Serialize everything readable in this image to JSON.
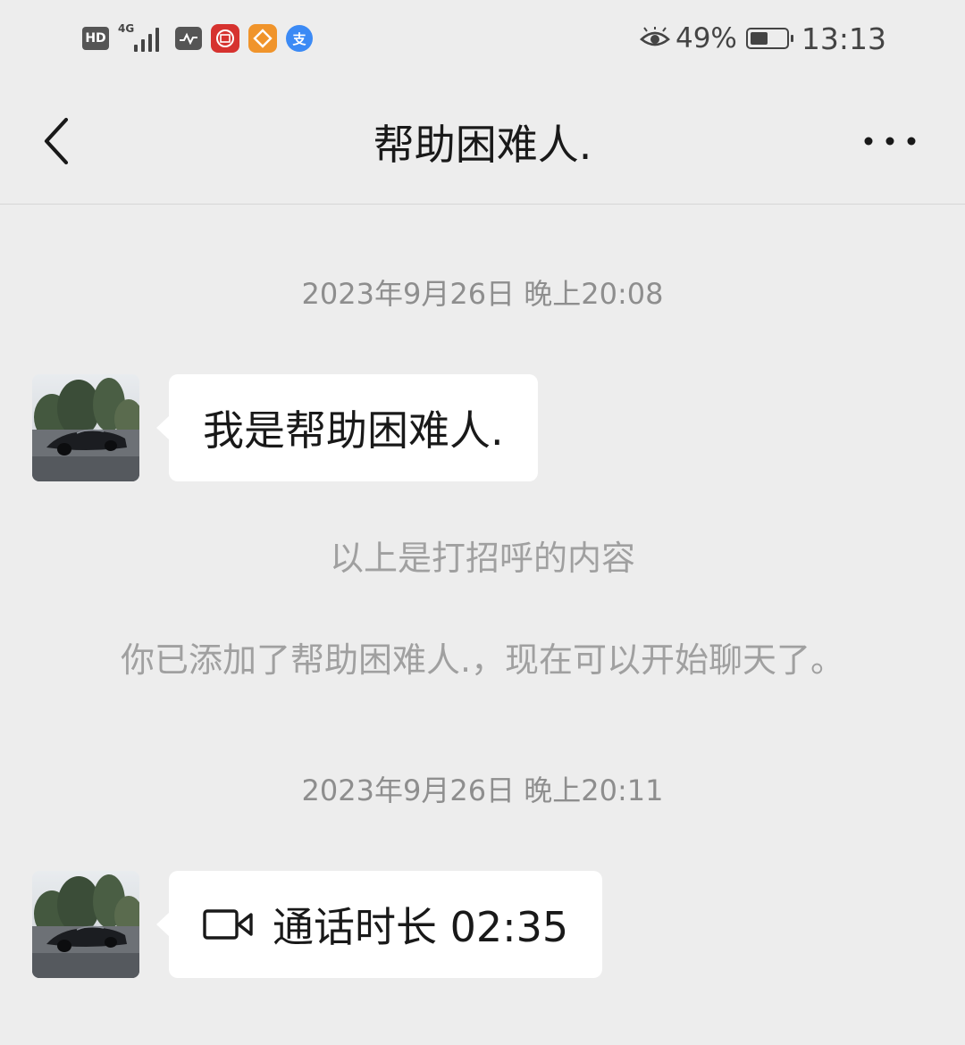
{
  "status_bar": {
    "hd_label": "HD",
    "network_label": "4G",
    "app_icons": [
      "activity-monitor-icon",
      "bank-app-icon",
      "orange-app-icon",
      "alipay-icon"
    ],
    "alipay_glyph": "支",
    "battery_percent": "49%",
    "battery_level": 0.49,
    "time": "13:13"
  },
  "nav": {
    "title": "帮助困难人."
  },
  "messages": {
    "timestamp_1": "2023年9月26日 晚上20:08",
    "greeting_text": "我是帮助困难人.",
    "note_greeting": "以上是打招呼的内容",
    "note_added": "你已添加了帮助困难人.，现在可以开始聊天了。",
    "timestamp_2": "2023年9月26日 晚上20:11",
    "call_text": "通话时长 02:35"
  },
  "colors": {
    "background": "#ededed",
    "bubble": "#ffffff",
    "timestamp_text": "#8e8e8e",
    "note_text": "#a0a0a0"
  }
}
